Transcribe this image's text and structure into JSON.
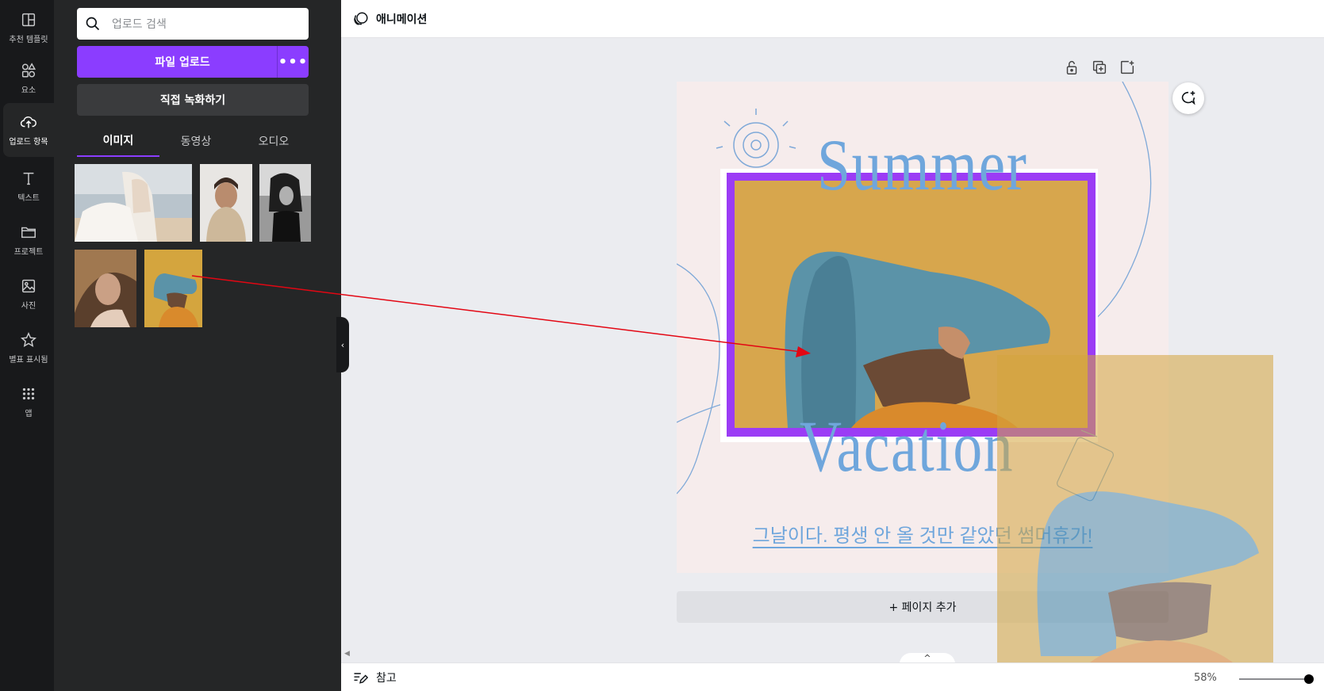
{
  "rail": {
    "items": [
      {
        "label": "추천 템플릿",
        "icon": "template-icon"
      },
      {
        "label": "요소",
        "icon": "elements-icon"
      },
      {
        "label": "업로드 항목",
        "icon": "upload-cloud-icon"
      },
      {
        "label": "텍스트",
        "icon": "text-icon"
      },
      {
        "label": "프로젝트",
        "icon": "folder-icon"
      },
      {
        "label": "사진",
        "icon": "photo-icon"
      },
      {
        "label": "별표 표시됨",
        "icon": "star-icon"
      },
      {
        "label": "앱",
        "icon": "apps-grid-icon"
      }
    ],
    "active_index": 2
  },
  "panel": {
    "search_placeholder": "업로드 검색",
    "upload_label": "파일 업로드",
    "more_label": "•••",
    "record_label": "직접 녹화하기",
    "tabs": [
      {
        "label": "이미지",
        "active": true
      },
      {
        "label": "동영상",
        "active": false
      },
      {
        "label": "오디오",
        "active": false
      }
    ]
  },
  "topbar": {
    "animation_label": "애니메이션"
  },
  "design": {
    "title_top": "Summer",
    "title_bottom": "Vacation",
    "subtitle": "그날이다. 평생 안 올 것만 같았던 썸머휴가!"
  },
  "add_page_label": "+ 페이지 추가",
  "bottombar": {
    "notes_label": "참고",
    "zoom": "58%"
  },
  "colors": {
    "accent": "#8b3dff",
    "title_blue": "#6fa6dc",
    "page_bg": "#f6ecec",
    "arrow_red": "#e30613"
  }
}
